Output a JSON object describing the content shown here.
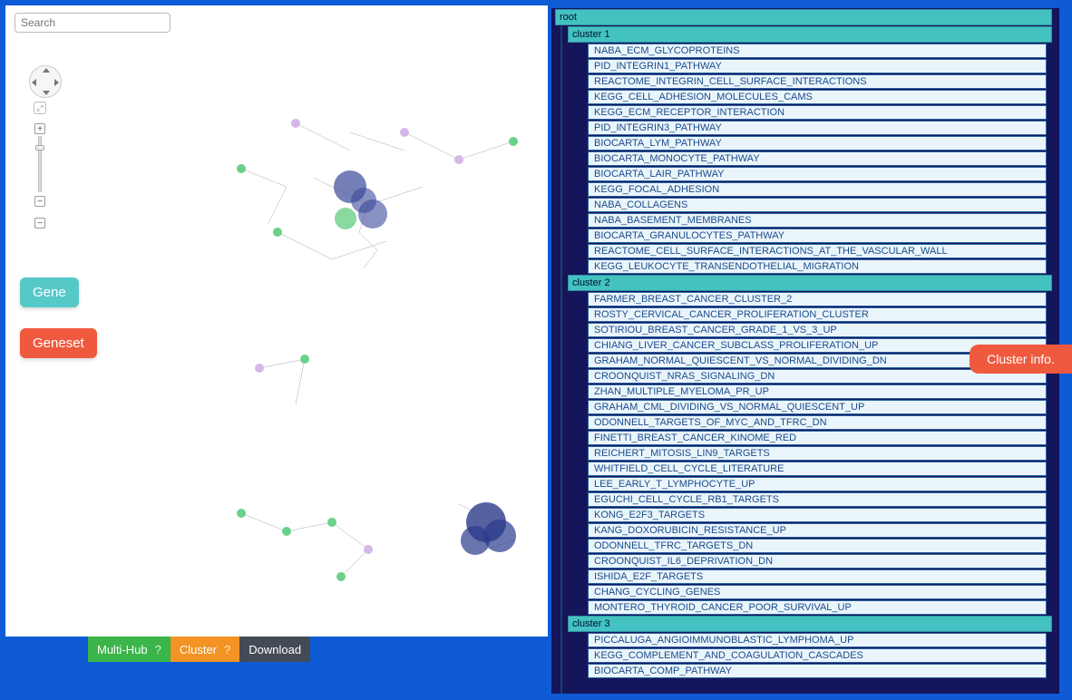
{
  "search": {
    "placeholder": "Search"
  },
  "buttons": {
    "gene": "Gene",
    "geneset": "Geneset"
  },
  "bottombar": {
    "multihub": "Multi-Hub",
    "cluster": "Cluster",
    "download": "Download",
    "help": "?"
  },
  "sidetab": {
    "clusterinfo": "Cluster info."
  },
  "tree": {
    "root": "root",
    "clusters": [
      {
        "label": "cluster 1",
        "items": [
          "NABA_ECM_GLYCOPROTEINS",
          "PID_INTEGRIN1_PATHWAY",
          "REACTOME_INTEGRIN_CELL_SURFACE_INTERACTIONS",
          "KEGG_CELL_ADHESION_MOLECULES_CAMS",
          "KEGG_ECM_RECEPTOR_INTERACTION",
          "PID_INTEGRIN3_PATHWAY",
          "BIOCARTA_LYM_PATHWAY",
          "BIOCARTA_MONOCYTE_PATHWAY",
          "BIOCARTA_LAIR_PATHWAY",
          "KEGG_FOCAL_ADHESION",
          "NABA_COLLAGENS",
          "NABA_BASEMENT_MEMBRANES",
          "BIOCARTA_GRANULOCYTES_PATHWAY",
          "REACTOME_CELL_SURFACE_INTERACTIONS_AT_THE_VASCULAR_WALL",
          "KEGG_LEUKOCYTE_TRANSENDOTHELIAL_MIGRATION"
        ]
      },
      {
        "label": "cluster 2",
        "items": [
          "FARMER_BREAST_CANCER_CLUSTER_2",
          "ROSTY_CERVICAL_CANCER_PROLIFERATION_CLUSTER",
          "SOTIRIOU_BREAST_CANCER_GRADE_1_VS_3_UP",
          "CHIANG_LIVER_CANCER_SUBCLASS_PROLIFERATION_UP",
          "GRAHAM_NORMAL_QUIESCENT_VS_NORMAL_DIVIDING_DN",
          "CROONQUIST_NRAS_SIGNALING_DN",
          "ZHAN_MULTIPLE_MYELOMA_PR_UP",
          "GRAHAM_CML_DIVIDING_VS_NORMAL_QUIESCENT_UP",
          "ODONNELL_TARGETS_OF_MYC_AND_TFRC_DN",
          "FINETTI_BREAST_CANCER_KINOME_RED",
          "REICHERT_MITOSIS_LIN9_TARGETS",
          "WHITFIELD_CELL_CYCLE_LITERATURE",
          "LEE_EARLY_T_LYMPHOCYTE_UP",
          "EGUCHI_CELL_CYCLE_RB1_TARGETS",
          "KONG_E2F3_TARGETS",
          "KANG_DOXORUBICIN_RESISTANCE_UP",
          "ODONNELL_TFRC_TARGETS_DN",
          "CROONQUIST_IL6_DEPRIVATION_DN",
          "ISHIDA_E2F_TARGETS",
          "CHANG_CYCLING_GENES",
          "MONTERO_THYROID_CANCER_POOR_SURVIVAL_UP"
        ]
      },
      {
        "label": "cluster 3",
        "items": [
          "PICCALUGA_ANGIOIMMUNOBLASTIC_LYMPHOMA_UP",
          "KEGG_COMPLEMENT_AND_COAGULATION_CASCADES",
          "BIOCARTA_COMP_PATHWAY"
        ]
      }
    ]
  }
}
